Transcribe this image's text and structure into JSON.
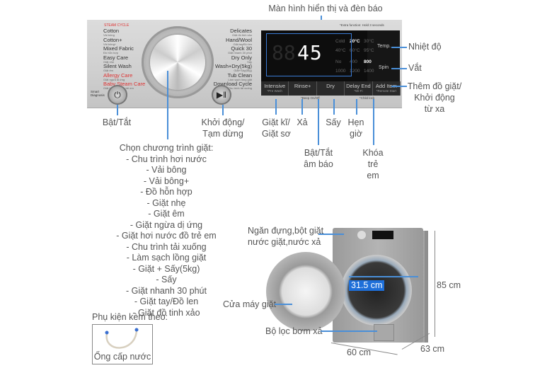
{
  "title": "Màn hình hiển thị và đèn báo",
  "panel": {
    "program_header": "STEAM CYCLE",
    "programs_left": [
      {
        "name": "Cotton",
        "sub": "Vải bông",
        "red": false
      },
      {
        "name": "Cotton+",
        "sub": "Vải bông+",
        "red": false
      },
      {
        "name": "Mixed Fabric",
        "sub": "Đồ hỗn hợp",
        "red": false
      },
      {
        "name": "Easy Care",
        "sub": "Giặt nhẹ",
        "red": false
      },
      {
        "name": "Silent Wash",
        "sub": "Giặt êm",
        "red": false
      },
      {
        "name": "Allergy Care",
        "sub": "Giặt ngừa dị ứng",
        "red": true
      },
      {
        "name": "Baby Steam Care",
        "sub": "Giặt hơi nước đồ trẻ em",
        "red": true
      }
    ],
    "programs_right": [
      {
        "name": "Delicates",
        "sub": "Giặt đồ tinh xảo"
      },
      {
        "name": "Hand/Wool",
        "sub": "Giặt tay/Đồ len"
      },
      {
        "name": "Quick 30",
        "sub": "Giặt nhanh 30 phút"
      },
      {
        "name": "Dry Only",
        "sub": "Sấy"
      },
      {
        "name": "Wash+Dry(5kg)",
        "sub": "Giặt+Sấy(5kg)"
      },
      {
        "name": "Tub Clean",
        "sub": "Làm sạch lồng giặt"
      },
      {
        "name": "Download Cycle",
        "sub": "Chu trình tải xuống"
      }
    ],
    "smart_diagnosis": "Smart Diagnosis",
    "power_icon": "power-icon",
    "start_pause_icon": "play-pause-icon",
    "display": {
      "time": "45",
      "temps": [
        "Cold",
        "20°C",
        "30°C",
        "40°C",
        "60°C",
        "95°C"
      ],
      "temp_selected": "20°C",
      "spins": [
        "No",
        "400",
        "800",
        "1000",
        "1200",
        "1400"
      ],
      "spin_selected": "800",
      "note": "*Extra function: Hold 3 seconds",
      "temp_label": "Temp.",
      "spin_label": "Spin"
    },
    "buttons": [
      {
        "label": "Intensive",
        "sub": "*Pre Wash"
      },
      {
        "label": "Rinse+",
        "sub": ""
      },
      {
        "label": "Dry",
        "sub": ""
      },
      {
        "label": "Delay End",
        "sub": "*Wi-Fi"
      },
      {
        "label": "Add Item",
        "sub": "*Remote Start"
      }
    ],
    "beep_note": "*Beep On/Off",
    "child_lock_note": "*Child lock"
  },
  "callouts": {
    "power": "Bật/Tắt",
    "start_pause": [
      "Khởi động/",
      "Tạm dừng"
    ],
    "intensive": [
      "Giặt kĩ/",
      "Giặt sơ"
    ],
    "rinse": "Xả",
    "beep": [
      "Bật/Tắt",
      "âm báo"
    ],
    "dry": "Sấy",
    "delay": [
      "Hẹn",
      "giờ"
    ],
    "child_lock": [
      "Khóa",
      "trẻ",
      "em"
    ],
    "temp": "Nhiệt độ",
    "spin": "Vắt",
    "add_item": [
      "Thêm đồ giặt/",
      "Khởi động",
      "từ xa"
    ]
  },
  "program_list": {
    "heading": "Chọn chương trình giặt:",
    "items": [
      "- Chu trình hơi nước",
      "- Vải bông",
      "- Vải bông+",
      "- Đồ hỗn hợp",
      "- Giặt nhẹ",
      "- Giặt êm",
      "- Giặt ngừa dị ứng",
      "- Giặt hơi nước đồ trẻ em",
      "- Chu trình tải xuống",
      "- Làm sạch lồng giặt",
      "- Giặt + Sấy(5kg)",
      "- Sấy",
      "- Giặt nhanh 30 phút",
      "- Giặt tay/Đồ len",
      "- Giặt đồ tinh xảo"
    ]
  },
  "accessories": {
    "heading": "Phụ kiện kèm theo:",
    "item": "Ống cấp nước"
  },
  "machine": {
    "detergent": [
      "Ngăn đựng,bột giặt",
      "nước giặt,nước xả"
    ],
    "door": "Cửa máy giặt",
    "filter": "Bộ lọc bơm xả",
    "drum_diameter": "31.5 cm",
    "height": "85 cm",
    "width": "60 cm",
    "depth": "63 cm"
  }
}
